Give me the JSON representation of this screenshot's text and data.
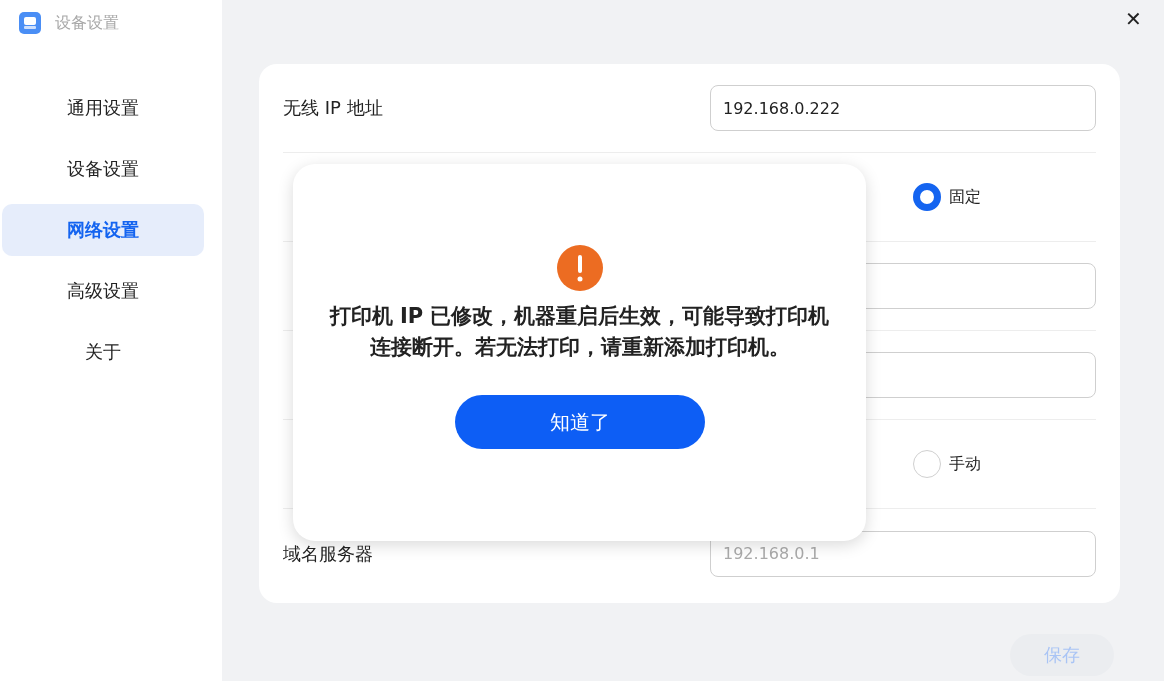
{
  "window": {
    "title": "设备设置",
    "close": "✕"
  },
  "sidebar": {
    "items": [
      {
        "label": "通用设置",
        "selected": false
      },
      {
        "label": "设备设置",
        "selected": false
      },
      {
        "label": "网络设置",
        "selected": true
      },
      {
        "label": "高级设置",
        "selected": false
      },
      {
        "label": "关于",
        "selected": false
      }
    ]
  },
  "form": {
    "rows": [
      {
        "kind": "field",
        "label": "无线 IP 地址",
        "value": "192.168.0.222"
      },
      {
        "kind": "radio",
        "options": [
          {
            "label": "固定",
            "selected": true
          }
        ]
      },
      {
        "kind": "field"
      },
      {
        "kind": "field"
      },
      {
        "kind": "radio",
        "options": [
          {
            "label": "手动",
            "selected": false
          }
        ]
      },
      {
        "kind": "field",
        "label": "域名服务器",
        "placeholder": "192.168.0.1"
      }
    ]
  },
  "save_button": {
    "label": "保存",
    "disabled": true
  },
  "dialog": {
    "message": "打印机 IP 已修改，机器重启后生效，可能导致打印机连接断开。若无法打印，请重新添加打印机。",
    "button": "知道了"
  }
}
